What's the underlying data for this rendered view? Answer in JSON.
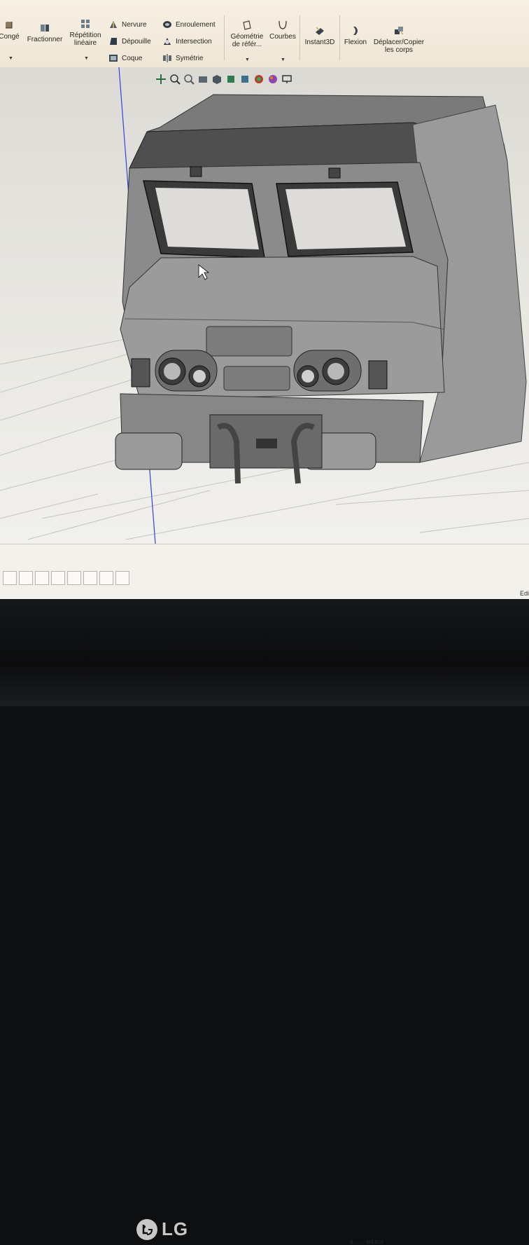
{
  "ribbon": {
    "conge": "Congé",
    "fractionner": "Fractionner",
    "repetition_1": "Répétition",
    "repetition_2": "linéaire",
    "nervure": "Nervure",
    "depouille": "Dépouille",
    "coque": "Coque",
    "enroulement": "Enroulement",
    "intersection": "Intersection",
    "symetrie": "Symétrie",
    "geometrie_1": "Géométrie",
    "geometrie_2": "de référ...",
    "courbes": "Courbes",
    "instant3d": "Instant3D",
    "flexion": "Flexion",
    "deplacer_1": "Déplacer/Copier",
    "deplacer_2": "les corps"
  },
  "status": {
    "right_text": "Edi"
  },
  "monitor": {
    "brand": "LG",
    "faint_labels": "S..... MENU"
  },
  "colors": {
    "ribbon_bg": "#f3ead9",
    "model_gray": "#8e8e8e",
    "model_dark": "#555555",
    "axis_blue": "#2b45d8"
  },
  "icons": [
    "fillet-icon",
    "split-icon",
    "linear-pattern-icon",
    "rib-icon",
    "draft-icon",
    "shell-icon",
    "wrap-icon",
    "intersect-icon",
    "mirror-icon",
    "reference-geometry-icon",
    "curves-icon",
    "instant3d-icon",
    "flex-icon",
    "move-copy-bodies-icon"
  ]
}
